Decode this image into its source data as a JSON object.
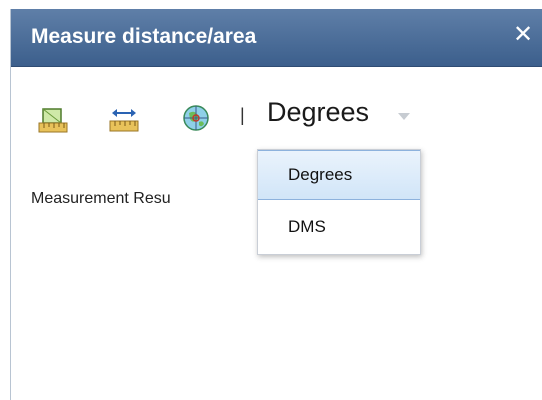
{
  "window": {
    "title": "Measure distance/area",
    "close_label": "✕"
  },
  "toolbar": {
    "tools": [
      {
        "name": "area-tool",
        "icon": "area-ruler-icon"
      },
      {
        "name": "distance-tool",
        "icon": "distance-ruler-icon"
      },
      {
        "name": "location-tool",
        "icon": "location-globe-icon"
      }
    ],
    "separator": "|",
    "unit_selected": "Degrees"
  },
  "results_label": "Measurement Resu",
  "dropdown": {
    "options": [
      "Degrees",
      "DMS"
    ],
    "selected_index": 0
  },
  "colors": {
    "titlebar": "#4a6d98",
    "selected_option": "#d9e9f9",
    "selected_border": "#8db2dd"
  }
}
